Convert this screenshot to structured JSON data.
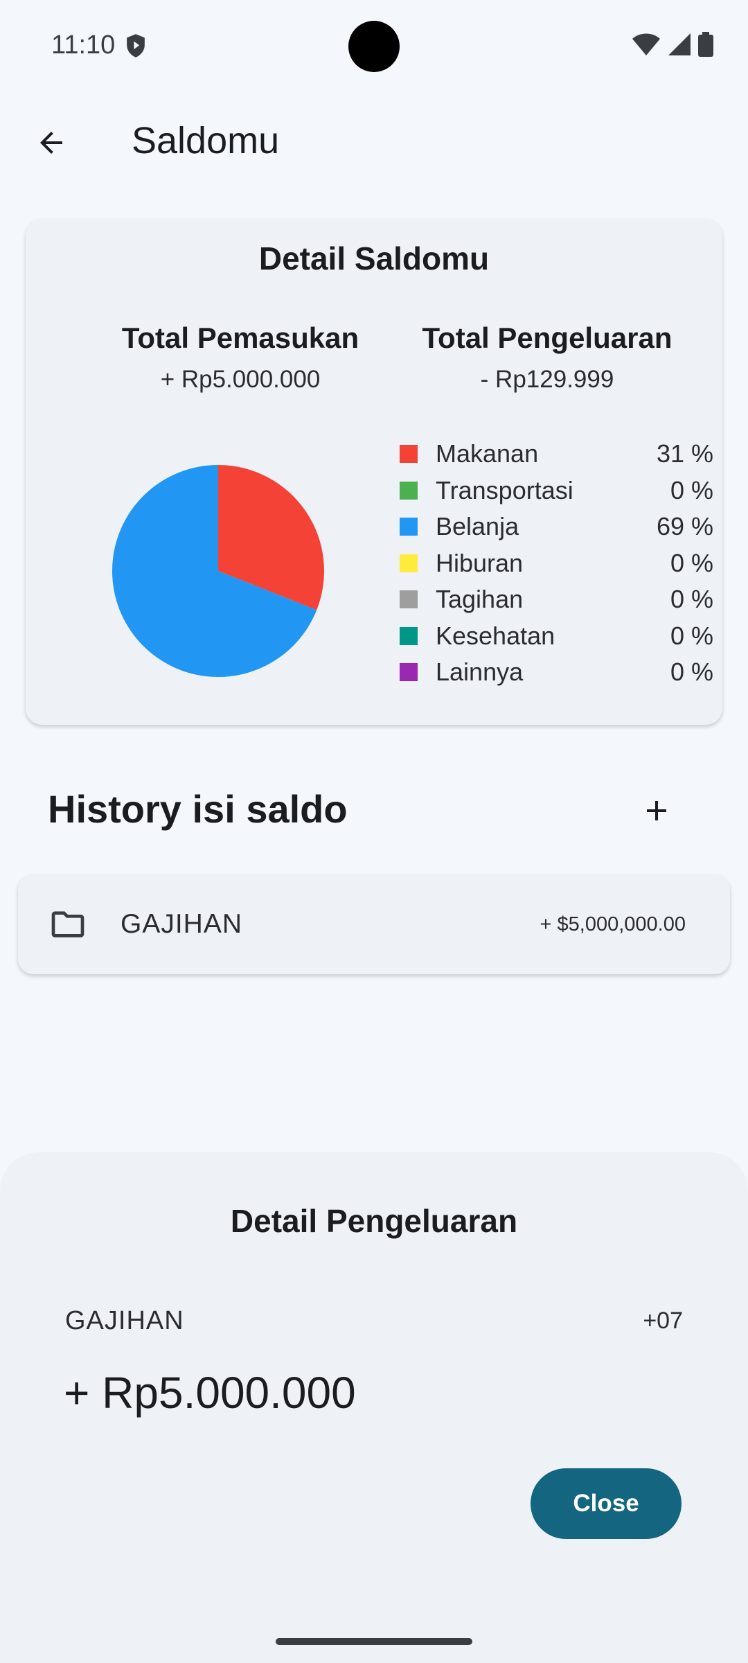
{
  "status_bar": {
    "time": "11:10"
  },
  "app_bar": {
    "title": "Saldomu"
  },
  "summary_card": {
    "title": "Detail Saldomu",
    "income_label": "Total Pemasukan",
    "income_value": "+ Rp5.000.000",
    "expense_label": "Total Pengeluaran",
    "expense_value": "- Rp129.999"
  },
  "chart_data": {
    "type": "pie",
    "slices": [
      {
        "label": "Makanan",
        "value": 31,
        "display": "31 %",
        "color": "#f44336"
      },
      {
        "label": "Transportasi",
        "value": 0,
        "display": "0 %",
        "color": "#4caf50"
      },
      {
        "label": "Belanja",
        "value": 69,
        "display": "69 %",
        "color": "#2196f3"
      },
      {
        "label": "Hiburan",
        "value": 0,
        "display": "0 %",
        "color": "#ffeb3b"
      },
      {
        "label": "Tagihan",
        "value": 0,
        "display": "0 %",
        "color": "#9e9e9e"
      },
      {
        "label": "Kesehatan",
        "value": 0,
        "display": "0 %",
        "color": "#009688"
      },
      {
        "label": "Lainnya",
        "value": 0,
        "display": "0 %",
        "color": "#9c27b0"
      }
    ],
    "legend": "right"
  },
  "history": {
    "title": "History isi saldo",
    "items": [
      {
        "name": "GAJIHAN",
        "amount": "+ $5,000,000.00",
        "icon": "folder-icon"
      }
    ]
  },
  "sheet": {
    "title": "Detail Pengeluaran",
    "name": "GAJIHAN",
    "timezone": "+07",
    "amount": "+ Rp5.000.000",
    "close_label": "Close"
  },
  "colors": {
    "primary": "#14657f",
    "background": "#f4f8fc",
    "surface": "#eef2f7"
  }
}
